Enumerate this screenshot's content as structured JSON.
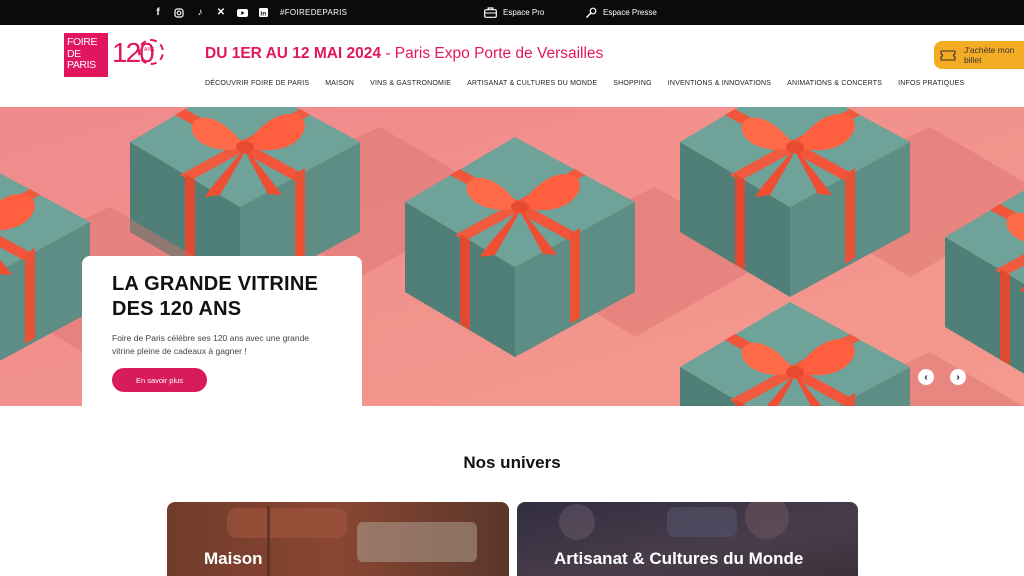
{
  "topbar": {
    "social_icons": [
      "facebook-icon",
      "instagram-icon",
      "tiktok-icon",
      "x-icon",
      "youtube-icon",
      "linkedin-icon"
    ],
    "hashtag": "#FOIREDEPARIS",
    "espace_pro": "Espace Pro",
    "espace_presse": "Espace Presse"
  },
  "header": {
    "logo": {
      "line1": "FOIRE",
      "line2": "DE",
      "line3": "PARIS",
      "anniversary": "120",
      "ans": "ANS"
    },
    "dates_bold": "DU 1ER AU 12 MAI 2024",
    "dates_rest": "- Paris Expo Porte de Versailles",
    "nav": [
      "DÉCOUVRIR FOIRE DE PARIS",
      "MAISON",
      "VINS & GASTRONOMIE",
      "ARTISANAT & CULTURES DU MONDE",
      "SHOPPING",
      "INVENTIONS & INNOVATIONS",
      "ANIMATIONS & CONCERTS",
      "INFOS PRATIQUES"
    ],
    "ticket_button": "J'achète mon billet"
  },
  "hero": {
    "title": "LA GRANDE VITRINE DES 120 ANS",
    "text": "Foire de Paris célèbre ses 120 ans avec une grande vitrine pleine de cadeaux à gagner !",
    "button": "En savoir plus",
    "prev_icon": "chevron-left-icon",
    "next_icon": "chevron-right-icon"
  },
  "univers": {
    "title": "Nos univers",
    "tiles": [
      "Maison",
      "Artisanat & Cultures du Monde"
    ]
  },
  "colors": {
    "brand_pink": "#e2165f",
    "accent_orange": "#f5ac25",
    "hero_bg": "#f28b8a",
    "topbar_bg": "#0b0b0b"
  }
}
